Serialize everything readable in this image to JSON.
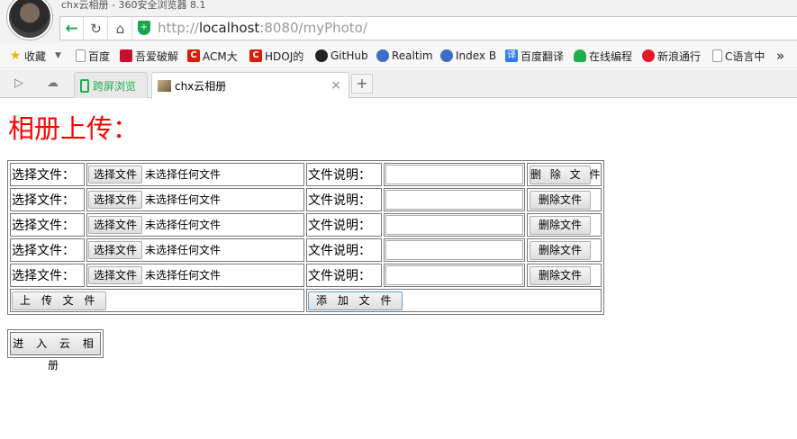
{
  "window": {
    "title": "chx云相册 - 360安全浏览器 8.1"
  },
  "nav": {
    "url_scheme": "http://",
    "url_host": "localhost",
    "url_rest": ":8080/myPhoto/"
  },
  "bookmarks": [
    {
      "label": "收藏",
      "icon": "star-icon",
      "color": "#f2b600"
    },
    {
      "label": "百度",
      "icon": "page-icon",
      "color": "#999999"
    },
    {
      "label": "吾爱破解",
      "icon": "52pojie-icon",
      "color": "#c8102e"
    },
    {
      "label": "ACM大",
      "icon": "csdn-icon",
      "color": "#d81e06"
    },
    {
      "label": "HDOJ的",
      "icon": "csdn-icon",
      "color": "#d81e06"
    },
    {
      "label": "GitHub",
      "icon": "github-icon",
      "color": "#222222"
    },
    {
      "label": "Realtim",
      "icon": "globe-icon",
      "color": "#3b6fc4"
    },
    {
      "label": "Index B",
      "icon": "globe-icon",
      "color": "#3b6fc4"
    },
    {
      "label": "百度翻译",
      "icon": "translate-icon",
      "color": "#2f7ef5"
    },
    {
      "label": "在线编程",
      "icon": "cloud-icon",
      "color": "#1fae4e"
    },
    {
      "label": "新浪通行",
      "icon": "weibo-icon",
      "color": "#e6162d"
    },
    {
      "label": "C语言中",
      "icon": "page-icon",
      "color": "#999999"
    },
    {
      "label": "»",
      "icon": "more-icon",
      "color": "#555555"
    }
  ],
  "tabs": [
    {
      "label": "跨屏浏览",
      "icon": "phone-icon",
      "color": "#1fae4e"
    },
    {
      "label": "chx云相册",
      "icon": "image-icon",
      "color": "#8a6a3a"
    }
  ],
  "page": {
    "title": "相册上传：",
    "choose_label": "选择文件：",
    "choose_button": "选择文件",
    "no_file": "未选择任何文件",
    "desc_label": "文件说明：",
    "delete_first": "删 除 文 件",
    "delete_button": "删除文件",
    "upload_button": "上 传 文 件",
    "add_button": "添 加 文 件",
    "enter_button": "进 入 云 相 册"
  },
  "colors": {
    "title": "#ff0000",
    "accent": "#18a64a"
  }
}
